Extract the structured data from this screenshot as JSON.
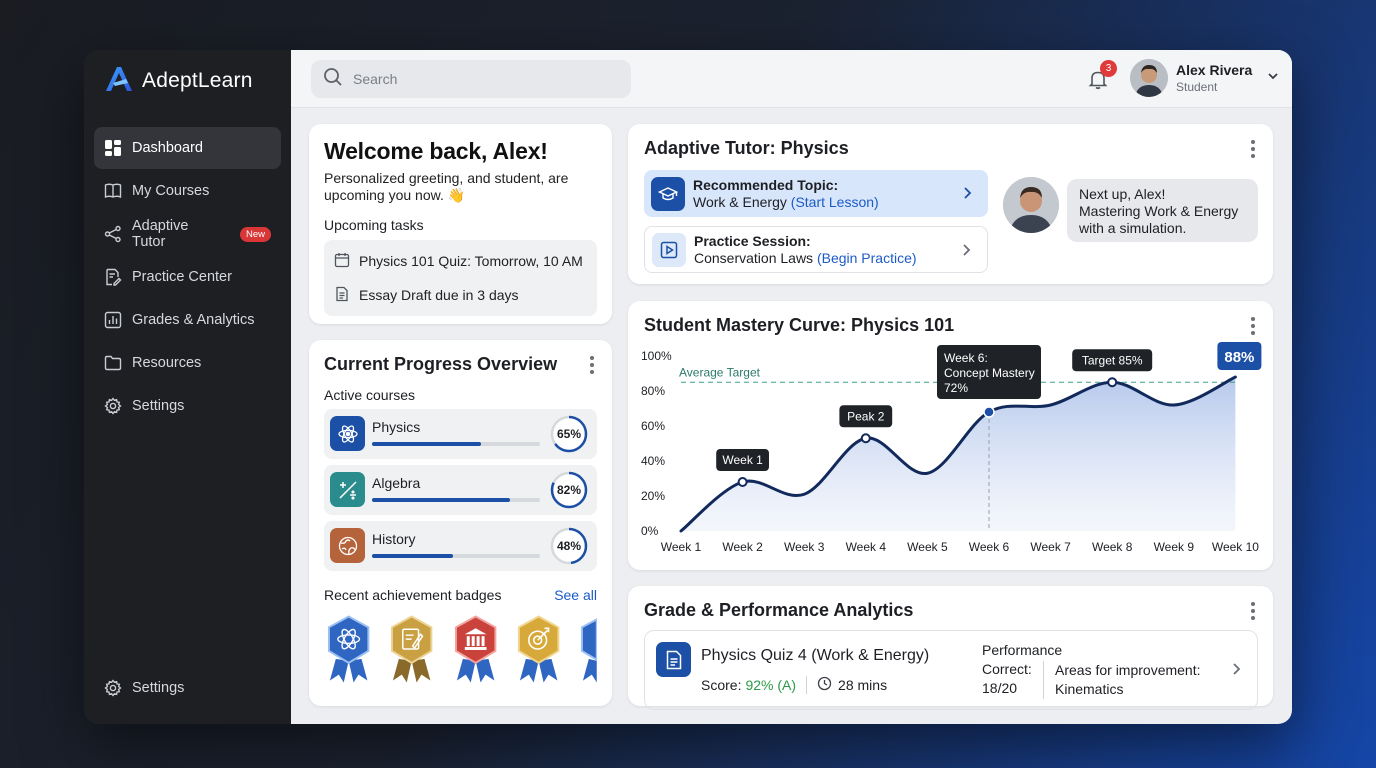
{
  "app": {
    "name": "AdeptLearn"
  },
  "sidebar": {
    "items": [
      {
        "label": "Dashboard",
        "icon": "dashboard-icon",
        "active": true
      },
      {
        "label": "My Courses",
        "icon": "book-icon"
      },
      {
        "label": "Adaptive Tutor",
        "icon": "share-nodes-icon",
        "badge": "New"
      },
      {
        "label": "Practice Center",
        "icon": "edit-document-icon"
      },
      {
        "label": "Grades & Analytics",
        "icon": "bar-chart-icon"
      },
      {
        "label": "Resources",
        "icon": "folder-icon"
      },
      {
        "label": "Settings",
        "icon": "gear-icon"
      }
    ],
    "bottom": {
      "label": "Settings",
      "icon": "gear-icon"
    }
  },
  "topbar": {
    "search_placeholder": "Search",
    "notifications_count": "3",
    "user": {
      "name": "Alex Rivera",
      "role": "Student"
    }
  },
  "welcome": {
    "title": "Welcome back, Alex!",
    "subtitle_line1": "Personalized greeting, and student, are",
    "subtitle_line2": "upcoming you now. 👋",
    "tasks_heading": "Upcoming tasks",
    "tasks": [
      {
        "text": "Physics 101 Quiz: Tomorrow, 10 AM",
        "icon": "calendar-icon"
      },
      {
        "text": "Essay Draft due in 3 days",
        "icon": "document-icon"
      }
    ]
  },
  "progress": {
    "title": "Current Progress Overview",
    "courses_heading": "Active courses",
    "courses": [
      {
        "name": "Physics",
        "percent": 65,
        "label": "65%",
        "color": "#1c4fa6",
        "icon": "atom-icon"
      },
      {
        "name": "Algebra",
        "percent": 82,
        "label": "82%",
        "color": "#2a8c8c",
        "icon": "math-icon"
      },
      {
        "name": "History",
        "percent": 48,
        "label": "48%",
        "color": "#b5633a",
        "icon": "globe-icon"
      }
    ],
    "badges_heading": "Recent achievement badges",
    "see_all": "See all",
    "badges": [
      {
        "icon": "atom-badge-icon",
        "color": "#2f66c2"
      },
      {
        "icon": "notepad-badge-icon",
        "color": "#c9a042"
      },
      {
        "icon": "museum-badge-icon",
        "color": "#c9423c"
      },
      {
        "icon": "target-badge-icon",
        "color": "#d7a93a"
      },
      {
        "icon": "partial-badge-icon",
        "color": "#2f66c2"
      }
    ]
  },
  "tutor": {
    "title": "Adaptive Tutor: Physics",
    "recommended": {
      "heading": "Recommended Topic:",
      "topic": "Work & Energy",
      "action": "(Start Lesson)"
    },
    "practice": {
      "heading": "Practice Session:",
      "topic": "Conservation Laws",
      "action": "(Begin Practice)"
    },
    "bubble_line1": "Next up, Alex!",
    "bubble_line2": "Mastering Work & Energy",
    "bubble_line3": "with a simulation."
  },
  "chart_data": {
    "type": "area",
    "title": "Student Mastery Curve: Physics 101",
    "categories": [
      "Week 1",
      "Week 2",
      "Week 3",
      "Week 4",
      "Week 5",
      "Week 6",
      "Week 7",
      "Week 8",
      "Week 9",
      "Week 10"
    ],
    "series": [
      {
        "values": [
          0,
          28,
          21,
          53,
          33,
          68,
          72,
          85,
          72,
          88
        ]
      }
    ],
    "start_value": 0,
    "ylim": [
      0,
      100
    ],
    "yticks": [
      "0%",
      "20%",
      "40%",
      "60%",
      "80%",
      "100%"
    ],
    "reference_line": {
      "label": "Average Target",
      "value": 85
    },
    "annotations": [
      {
        "x": 1,
        "label": "Week 1"
      },
      {
        "x": 3,
        "label": "Peak 2"
      },
      {
        "x": 5,
        "line1": "Week 6:",
        "line2": "Concept Mastery",
        "line3": "72%"
      },
      {
        "x": 7,
        "label": "Target 85%"
      },
      {
        "x": 9,
        "label": "88%"
      }
    ]
  },
  "analytics": {
    "title": "Grade & Performance Analytics",
    "quiz": {
      "title": "Physics Quiz 4 (Work & Energy)",
      "score_label": "Score:",
      "score_value": "92% (A)",
      "duration": "28 mins",
      "performance_heading": "Performance",
      "correct_label": "Correct:",
      "correct_value": "18/20",
      "improve_label": "Areas for improvement:",
      "improve_value": "Kinematics"
    }
  }
}
